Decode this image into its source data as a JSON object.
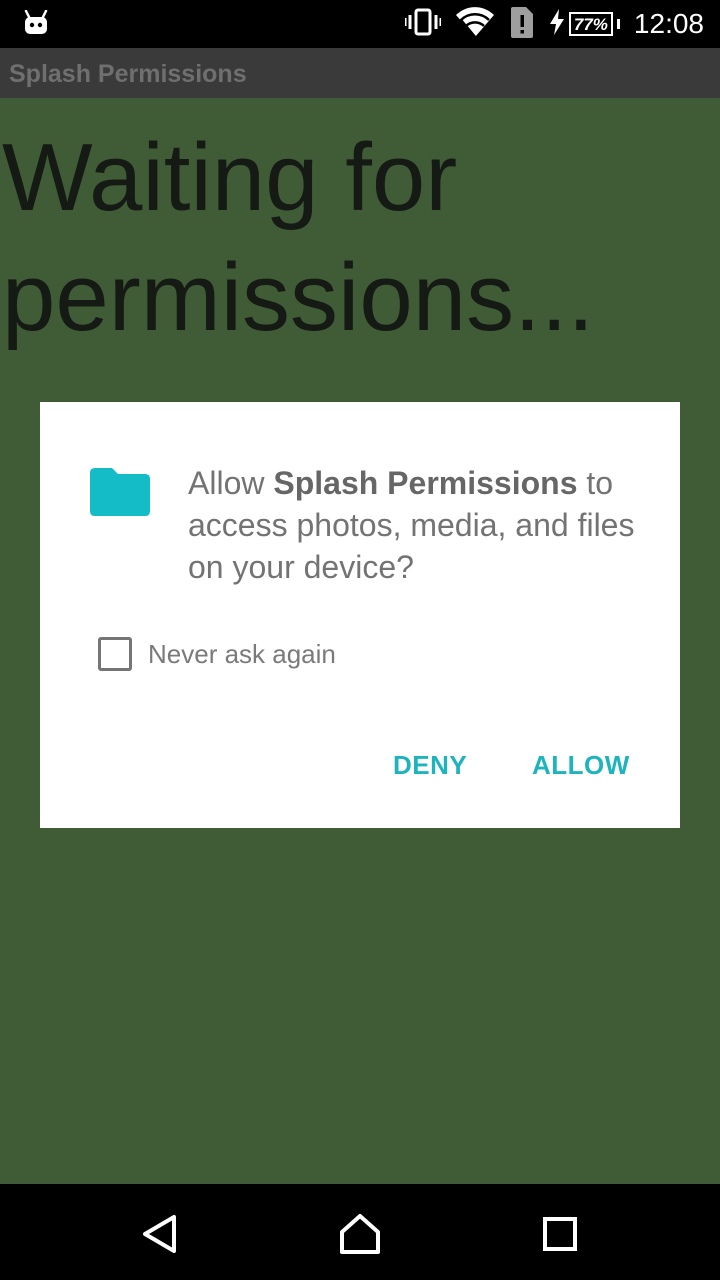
{
  "status_bar": {
    "battery_percent": "77%",
    "time": "12:08",
    "icons": [
      "android-notification-icon",
      "vibrate-icon",
      "wifi-icon",
      "sim-alert-icon",
      "charging-icon",
      "battery-icon"
    ]
  },
  "app_bar": {
    "title": "Splash Permissions"
  },
  "content": {
    "waiting_text": "Waiting for permissions..."
  },
  "dialog": {
    "icon": "folder-icon",
    "message_prefix": "Allow ",
    "app_name": "Splash Permissions",
    "message_suffix": " to access photos, media, and files on your device?",
    "never_ask_label": "Never ask again",
    "never_ask_checked": false,
    "deny_label": "DENY",
    "allow_label": "ALLOW",
    "accent_color": "#1eb4be"
  },
  "nav_bar": {
    "buttons": [
      "back-icon",
      "home-icon",
      "recent-apps-icon"
    ]
  },
  "colors": {
    "content_background": "#405c37",
    "app_bar_background": "#3a3a3a",
    "dialog_background": "#ffffff",
    "folder_icon": "#13bcc6"
  }
}
